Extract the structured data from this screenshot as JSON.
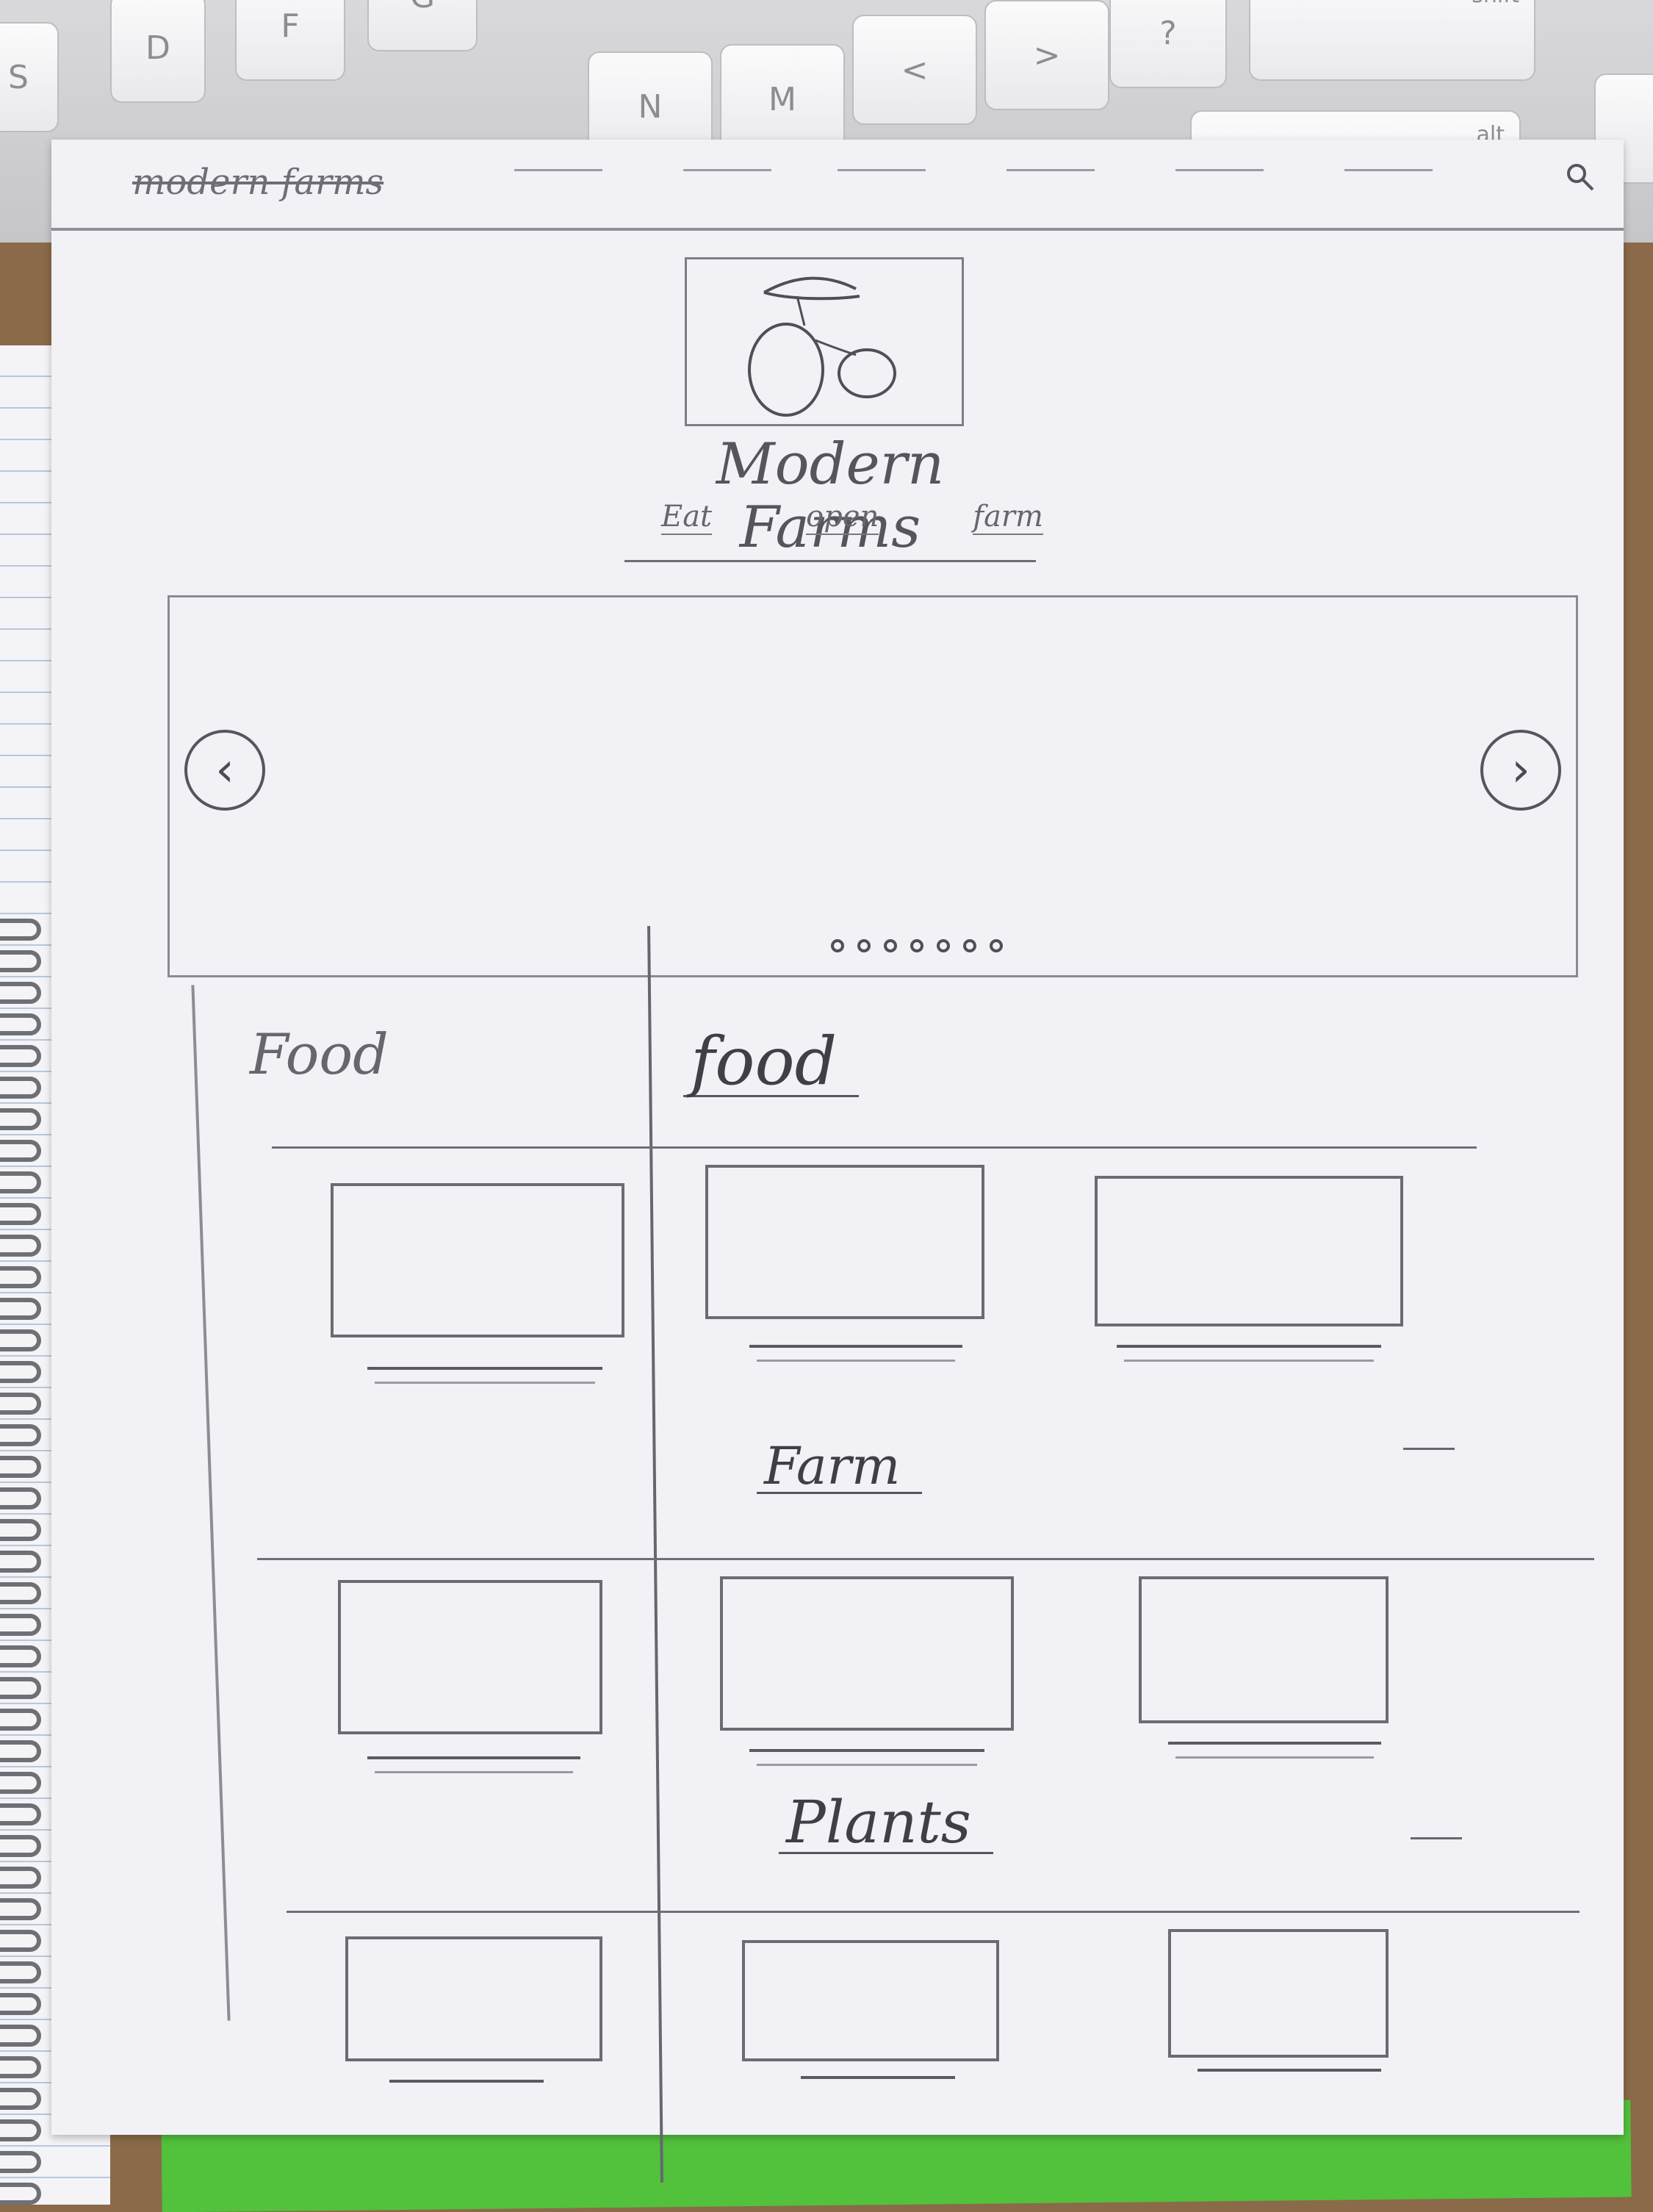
{
  "keyboard": {
    "keys": [
      {
        "label": "S"
      },
      {
        "label": "D"
      },
      {
        "label": "F"
      },
      {
        "label": "G"
      },
      {
        "label": "N"
      },
      {
        "label": "M"
      },
      {
        "label": "<",
        "sub": ","
      },
      {
        "label": ">",
        "sub": "."
      },
      {
        "label": "?",
        "sub": "/"
      },
      {
        "label": "shift"
      },
      {
        "label": "alt"
      }
    ]
  },
  "page": {
    "nav": {
      "site_name": "modern farms"
    },
    "brand": {
      "title": "Modern Farms",
      "links": [
        "Eat",
        "open",
        "farm"
      ]
    },
    "sidebar": {
      "title": "Food"
    },
    "sections": [
      {
        "title": "food"
      },
      {
        "title": "Farm"
      },
      {
        "title": "Plants"
      }
    ]
  },
  "icons": {
    "search": "search-icon",
    "prev": "chevron-left-icon",
    "next": "chevron-right-icon",
    "logo": "fruit-logo-icon"
  },
  "colors": {
    "paper": "#f2f1f5",
    "pencil": "#5f5f66",
    "desk": "#8a6a48",
    "accent_green": "#52c13c"
  }
}
